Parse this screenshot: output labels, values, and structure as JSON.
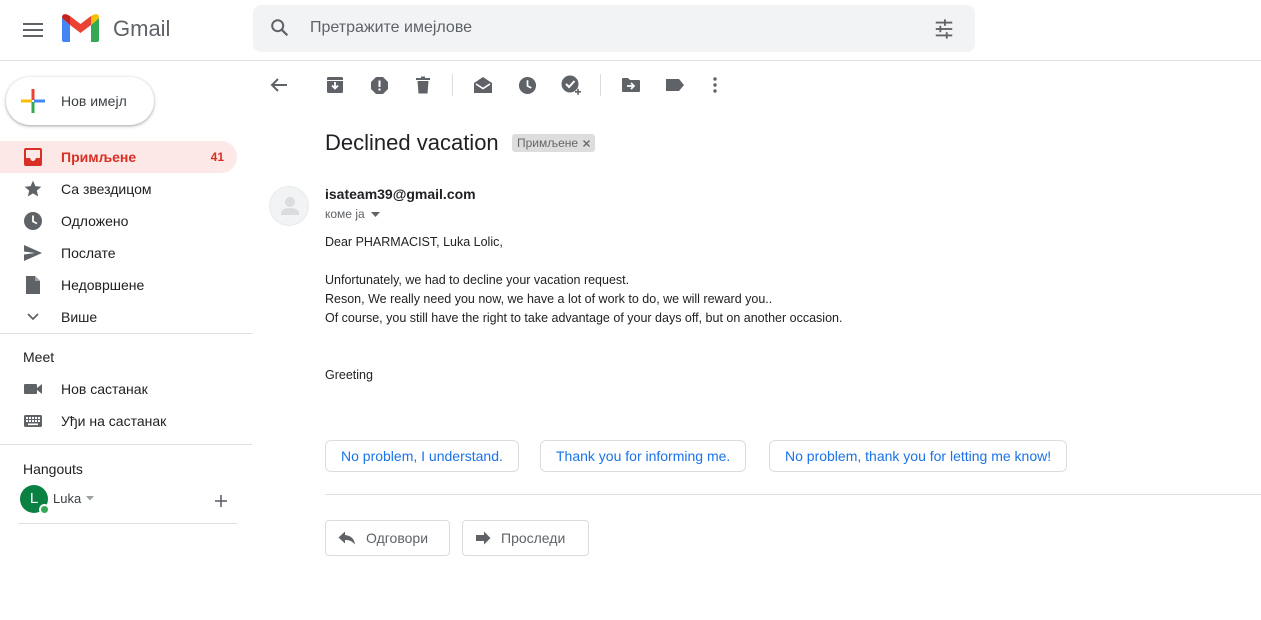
{
  "header": {
    "app_name": "Gmail",
    "search_placeholder": "Претражите имејлове"
  },
  "sidebar": {
    "compose_label": "Нов имејл",
    "items": [
      {
        "label": "Примљене",
        "count": "41",
        "icon": "inbox-icon"
      },
      {
        "label": "Са звездицом",
        "icon": "star-icon"
      },
      {
        "label": "Одложено",
        "icon": "clock-icon"
      },
      {
        "label": "Послате",
        "icon": "send-icon"
      },
      {
        "label": "Недовршене",
        "icon": "draft-icon"
      },
      {
        "label": "Више",
        "icon": "chevron-down-icon"
      }
    ],
    "meet": {
      "title": "Meet",
      "items": [
        {
          "label": "Нов састанак",
          "icon": "video-camera-icon"
        },
        {
          "label": "Уђи на састанак",
          "icon": "keyboard-icon"
        }
      ]
    },
    "hangouts": {
      "title": "Hangouts",
      "user_name": "Luka",
      "user_initial": "L"
    }
  },
  "toolbar": {
    "icons": [
      "back-arrow-icon",
      "archive-icon",
      "report-spam-icon",
      "delete-icon",
      "mark-unread-icon",
      "snooze-icon",
      "add-to-tasks-icon",
      "move-to-icon",
      "label-icon",
      "more-vert-icon"
    ]
  },
  "message": {
    "subject": "Declined vacation",
    "label_chip": "Примљене",
    "sender": "isateam39@gmail.com",
    "to": "коме ја",
    "body": [
      "Dear PHARMACIST, Luka Lolic,",
      "Unfortunately, we had to decline your vacation request.",
      "Reson, We really need you now, we have a lot of work to do, we will reward you..",
      "Of course, you still have the right to take advantage of your days off, but on another occasion.",
      "Greeting"
    ],
    "smart_replies": [
      "No problem, I understand.",
      "Thank you for informing me.",
      "No problem, thank you for letting me know!"
    ],
    "reply_label": "Одговори",
    "forward_label": "Проследи"
  },
  "colors": {
    "accent_red": "#d93025",
    "active_bg": "#fce8e6",
    "link_blue": "#1a73e8",
    "avatar_green": "#0b8043"
  }
}
